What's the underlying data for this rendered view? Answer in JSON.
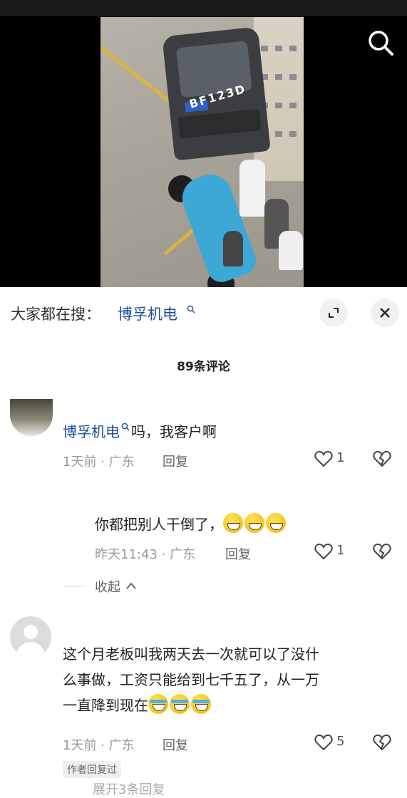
{
  "video": {
    "plate_text": "BF123D"
  },
  "search": {
    "prefix": "大家都在搜：",
    "term": "博孚机电"
  },
  "comments_header": "89条评论",
  "comments": [
    {
      "link_text": "博孚机电",
      "text_after": "吗，我客户啊",
      "meta": "1天前 · 广东",
      "reply_label": "回复",
      "likes": "1"
    },
    {
      "text": "你都把别人干倒了，",
      "meta": "昨天11:43 · 广东",
      "reply_label": "回复",
      "likes": "1"
    },
    {
      "line1": "这个月老板叫我两天去一次就可以了没什",
      "line2": "么事做，工资只能给到七千五了，从一万",
      "line3": "一直降到现在",
      "meta": "1天前 · 广东",
      "reply_label": "回复",
      "likes": "5",
      "badge": "作者回复过"
    }
  ],
  "collapse_label": "收起",
  "more_replies_partial": "展开3条回复",
  "icons": {
    "search": "search-icon",
    "expand": "expand-icon",
    "close": "close-icon",
    "like": "heart-icon",
    "dislike": "broken-heart-icon",
    "collapse": "chevron-up-icon"
  },
  "colors": {
    "link": "#1f4f9f",
    "meta": "#9a9a9a",
    "accent_blue": "#3da7d6"
  }
}
